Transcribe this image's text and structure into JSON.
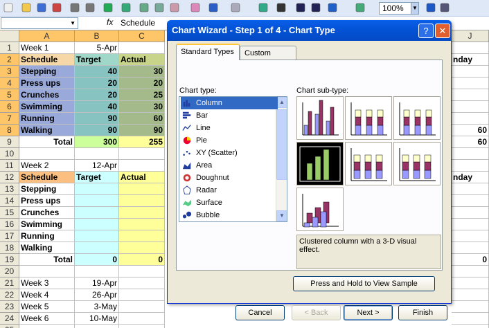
{
  "toolbar": {
    "icons": [
      "new-icon",
      "open-icon",
      "save-icon",
      "permission-icon",
      "print-icon",
      "print-preview-icon",
      "spelling-icon",
      "research-icon",
      "cut-icon",
      "copy-icon",
      "paste-icon",
      "format-painter-icon",
      "undo-icon",
      "redo-icon",
      "hyperlink-icon",
      "autosum-icon",
      "sort-ascending-icon",
      "sort-descending-icon",
      "chart-wizard-icon",
      "drawing-icon",
      "help-icon",
      "options-icon"
    ],
    "zoom": "100%"
  },
  "formula_bar": {
    "name_box": "",
    "fx": "fx",
    "value": "Schedule"
  },
  "columns": [
    "A",
    "B",
    "C",
    "J"
  ],
  "rows": {
    "r1": {
      "num": "1",
      "a": "Week 1",
      "b": "5-Apr"
    },
    "r2": {
      "num": "2",
      "a": "Schedule",
      "b": "Target",
      "c": "Actual",
      "j": "nday"
    },
    "r3": {
      "num": "3",
      "a": "Stepping",
      "b": "40",
      "c": "30"
    },
    "r4": {
      "num": "4",
      "a": "Press ups",
      "b": "20",
      "c": "20"
    },
    "r5": {
      "num": "5",
      "a": "Crunches",
      "b": "20",
      "c": "25"
    },
    "r6": {
      "num": "6",
      "a": "Swimming",
      "b": "40",
      "c": "30"
    },
    "r7": {
      "num": "7",
      "a": "Running",
      "b": "90",
      "c": "60"
    },
    "r8": {
      "num": "8",
      "a": "Walking",
      "b": "90",
      "c": "90",
      "j": "60"
    },
    "r9": {
      "num": "9",
      "a": "Total",
      "b": "300",
      "c": "255",
      "j": "60"
    },
    "r10": {
      "num": "10"
    },
    "r11": {
      "num": "11",
      "a": "Week 2",
      "b": "12-Apr"
    },
    "r12": {
      "num": "12",
      "a": "Schedule",
      "b": "Target",
      "c": "Actual",
      "j": "nday"
    },
    "r13": {
      "num": "13",
      "a": "Stepping"
    },
    "r14": {
      "num": "14",
      "a": "Press ups"
    },
    "r15": {
      "num": "15",
      "a": "Crunches"
    },
    "r16": {
      "num": "16",
      "a": "Swimming"
    },
    "r17": {
      "num": "17",
      "a": "Running"
    },
    "r18": {
      "num": "18",
      "a": "Walking"
    },
    "r19": {
      "num": "19",
      "a": "Total",
      "b": "0",
      "c": "0",
      "j": "0"
    },
    "r20": {
      "num": "20"
    },
    "r21": {
      "num": "21",
      "a": "Week 3",
      "b": "19-Apr"
    },
    "r22": {
      "num": "22",
      "a": "Week 4",
      "b": "26-Apr"
    },
    "r23": {
      "num": "23",
      "a": "Week 5",
      "b": "3-May"
    },
    "r24": {
      "num": "24",
      "a": "Week 6",
      "b": "10-May"
    },
    "r25": {
      "num": "25"
    }
  },
  "dialog": {
    "title": "Chart Wizard - Step 1 of 4 - Chart Type",
    "help": "?",
    "close": "✕",
    "tabs": [
      "Standard Types",
      "Custom Types"
    ],
    "chart_type_label": "Chart type:",
    "subtype_label": "Chart sub-type:",
    "chart_types": [
      "Column",
      "Bar",
      "Line",
      "Pie",
      "XY (Scatter)",
      "Area",
      "Doughnut",
      "Radar",
      "Surface",
      "Bubble"
    ],
    "selected_type": "Column",
    "description": "Clustered column with a 3-D visual effect.",
    "sample_button": "Press and Hold to View Sample",
    "buttons": {
      "cancel": "Cancel",
      "back": "< Back",
      "next": "Next >",
      "finish": "Finish"
    }
  }
}
